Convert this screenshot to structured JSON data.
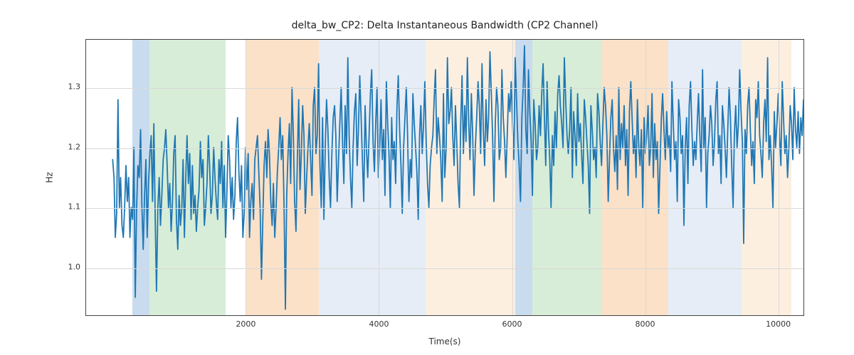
{
  "chart_data": {
    "type": "line",
    "title": "delta_bw_CP2: Delta Instantaneous Bandwidth (CP2 Channel)",
    "xlabel": "Time(s)",
    "ylabel": "Hz",
    "xlim": [
      -400,
      10400
    ],
    "ylim": [
      0.92,
      1.38
    ],
    "xticks": [
      2000,
      4000,
      6000,
      8000,
      10000
    ],
    "yticks": [
      1.0,
      1.1,
      1.2,
      1.3
    ],
    "line_color": "#1f77b4",
    "regions": [
      {
        "x0": 300,
        "x1": 550,
        "color": "#9dbde0",
        "alpha": 0.55
      },
      {
        "x0": 550,
        "x1": 1700,
        "color": "#b7deb7",
        "alpha": 0.55
      },
      {
        "x0": 2000,
        "x1": 3100,
        "color": "#f6c89b",
        "alpha": 0.55
      },
      {
        "x0": 3100,
        "x1": 4700,
        "color": "#c7d7ea",
        "alpha": 0.45
      },
      {
        "x0": 4700,
        "x1": 6050,
        "color": "#f9e2c7",
        "alpha": 0.55
      },
      {
        "x0": 6050,
        "x1": 6300,
        "color": "#9dbde0",
        "alpha": 0.55
      },
      {
        "x0": 6300,
        "x1": 7350,
        "color": "#b7deb7",
        "alpha": 0.55
      },
      {
        "x0": 7350,
        "x1": 8350,
        "color": "#f6c89b",
        "alpha": 0.55
      },
      {
        "x0": 8350,
        "x1": 9450,
        "color": "#c7d7ea",
        "alpha": 0.45
      },
      {
        "x0": 9450,
        "x1": 10200,
        "color": "#f9e2c7",
        "alpha": 0.55
      }
    ],
    "series": [
      {
        "name": "delta_bw_CP2",
        "x_step": 20,
        "y": [
          1.18,
          1.15,
          1.05,
          1.09,
          1.28,
          1.1,
          1.15,
          1.07,
          1.05,
          1.1,
          1.17,
          1.11,
          1.15,
          1.05,
          1.1,
          1.08,
          1.2,
          0.95,
          1.1,
          1.17,
          1.15,
          1.23,
          1.1,
          1.03,
          1.12,
          1.18,
          1.05,
          1.14,
          1.19,
          1.22,
          1.11,
          1.24,
          1.08,
          0.96,
          1.1,
          1.15,
          1.07,
          1.12,
          1.18,
          1.2,
          1.23,
          1.17,
          1.1,
          1.14,
          1.06,
          1.11,
          1.19,
          1.22,
          1.08,
          1.03,
          1.12,
          1.07,
          1.1,
          1.18,
          1.05,
          1.15,
          1.22,
          1.14,
          1.19,
          1.08,
          1.17,
          1.09,
          1.12,
          1.06,
          1.1,
          1.13,
          1.21,
          1.15,
          1.18,
          1.07,
          1.1,
          1.14,
          1.22,
          1.17,
          1.09,
          1.12,
          1.2,
          1.15,
          1.11,
          1.08,
          1.18,
          1.14,
          1.21,
          1.1,
          1.17,
          1.05,
          1.13,
          1.22,
          1.18,
          1.1,
          1.15,
          1.08,
          1.12,
          1.21,
          1.25,
          1.16,
          1.11,
          1.17,
          1.05,
          1.09,
          1.2,
          1.13,
          1.19,
          1.05,
          1.11,
          1.14,
          1.08,
          1.18,
          1.2,
          1.22,
          1.16,
          1.1,
          0.98,
          1.08,
          1.17,
          1.21,
          1.15,
          1.23,
          1.19,
          1.11,
          1.07,
          1.14,
          1.05,
          1.1,
          1.16,
          1.2,
          1.25,
          1.18,
          1.22,
          1.1,
          0.93,
          1.12,
          1.19,
          1.24,
          1.14,
          1.3,
          1.22,
          1.11,
          1.06,
          1.18,
          1.28,
          1.13,
          1.19,
          1.27,
          1.22,
          1.09,
          1.15,
          1.2,
          1.24,
          1.18,
          1.12,
          1.27,
          1.3,
          1.19,
          1.22,
          1.34,
          1.17,
          1.1,
          1.25,
          1.08,
          1.2,
          1.28,
          1.23,
          1.15,
          1.1,
          1.19,
          1.25,
          1.27,
          1.22,
          1.11,
          1.18,
          1.24,
          1.3,
          1.21,
          1.14,
          1.27,
          1.19,
          1.35,
          1.22,
          1.15,
          1.1,
          1.2,
          1.26,
          1.29,
          1.17,
          1.23,
          1.32,
          1.25,
          1.18,
          1.11,
          1.27,
          1.2,
          1.15,
          1.22,
          1.29,
          1.33,
          1.21,
          1.16,
          1.24,
          1.3,
          1.15,
          1.2,
          1.28,
          1.18,
          1.23,
          1.12,
          1.31,
          1.24,
          1.19,
          1.1,
          1.25,
          1.18,
          1.21,
          1.14,
          1.27,
          1.32,
          1.23,
          1.17,
          1.09,
          1.2,
          1.25,
          1.3,
          1.22,
          1.11,
          1.18,
          1.15,
          1.29,
          1.24,
          1.2,
          1.16,
          1.08,
          1.22,
          1.27,
          1.19,
          1.24,
          1.31,
          1.21,
          1.14,
          1.1,
          1.17,
          1.2,
          1.22,
          1.28,
          1.33,
          1.19,
          1.25,
          1.22,
          1.18,
          1.11,
          1.29,
          1.15,
          1.2,
          1.35,
          1.24,
          1.26,
          1.3,
          1.22,
          1.17,
          1.27,
          1.21,
          1.14,
          1.1,
          1.24,
          1.32,
          1.19,
          1.27,
          1.21,
          1.35,
          1.24,
          1.18,
          1.29,
          1.22,
          1.12,
          1.2,
          1.25,
          1.31,
          1.27,
          1.19,
          1.34,
          1.23,
          1.17,
          1.28,
          1.21,
          1.25,
          1.36,
          1.29,
          1.22,
          1.11,
          1.24,
          1.3,
          1.27,
          1.18,
          1.2,
          1.33,
          1.25,
          1.21,
          1.15,
          1.22,
          1.29,
          1.26,
          1.31,
          1.24,
          1.18,
          1.35,
          1.28,
          1.21,
          1.17,
          1.11,
          1.25,
          1.3,
          1.37,
          1.23,
          1.19,
          1.33,
          1.26,
          1.21,
          1.12,
          1.28,
          1.24,
          1.18,
          1.2,
          1.27,
          1.22,
          1.29,
          1.34,
          1.25,
          1.17,
          1.31,
          1.23,
          1.18,
          1.1,
          1.22,
          1.17,
          1.26,
          1.2,
          1.29,
          1.32,
          1.27,
          1.24,
          1.2,
          1.35,
          1.28,
          1.22,
          1.19,
          1.23,
          1.3,
          1.15,
          1.26,
          1.22,
          1.17,
          1.29,
          1.21,
          1.24,
          1.19,
          1.14,
          1.28,
          1.25,
          1.21,
          1.17,
          1.09,
          1.27,
          1.23,
          1.18,
          1.2,
          1.15,
          1.29,
          1.26,
          1.21,
          1.17,
          1.24,
          1.3,
          1.27,
          1.22,
          1.11,
          1.18,
          1.25,
          1.28,
          1.2,
          1.16,
          1.22,
          1.13,
          1.3,
          1.18,
          1.24,
          1.2,
          1.27,
          1.17,
          1.23,
          1.12,
          1.26,
          1.31,
          1.25,
          1.19,
          1.22,
          1.15,
          1.28,
          1.2,
          1.17,
          1.23,
          1.1,
          1.25,
          1.19,
          1.22,
          1.27,
          1.17,
          1.2,
          1.29,
          1.15,
          1.24,
          1.18,
          1.21,
          1.09,
          1.17,
          1.25,
          1.29,
          1.23,
          1.18,
          1.26,
          1.2,
          1.22,
          1.16,
          1.31,
          1.24,
          1.18,
          1.21,
          1.11,
          1.28,
          1.25,
          1.19,
          1.22,
          1.07,
          1.2,
          1.25,
          1.14,
          1.27,
          1.31,
          1.23,
          1.17,
          1.21,
          1.18,
          1.24,
          1.29,
          1.22,
          1.16,
          1.33,
          1.2,
          1.25,
          1.1,
          1.19,
          1.22,
          1.27,
          1.24,
          1.17,
          1.21,
          1.28,
          1.31,
          1.19,
          1.22,
          1.14,
          1.27,
          1.24,
          1.2,
          1.15,
          1.23,
          1.3,
          1.25,
          1.17,
          1.1,
          1.22,
          1.27,
          1.2,
          1.24,
          1.33,
          1.26,
          1.21,
          1.04,
          1.23,
          1.19,
          1.27,
          1.3,
          1.23,
          1.17,
          1.21,
          1.14,
          1.28,
          1.25,
          1.31,
          1.22,
          1.19,
          1.15,
          1.24,
          1.28,
          1.21,
          1.35,
          1.18,
          1.22,
          1.17,
          1.1,
          1.26,
          1.2,
          1.24,
          1.29,
          1.22,
          1.17,
          1.31,
          1.25,
          1.19,
          1.22,
          1.15,
          1.2,
          1.27,
          1.24,
          1.18,
          1.3,
          1.23,
          1.2,
          1.26,
          1.19,
          1.25,
          1.22,
          1.28
        ]
      }
    ]
  }
}
